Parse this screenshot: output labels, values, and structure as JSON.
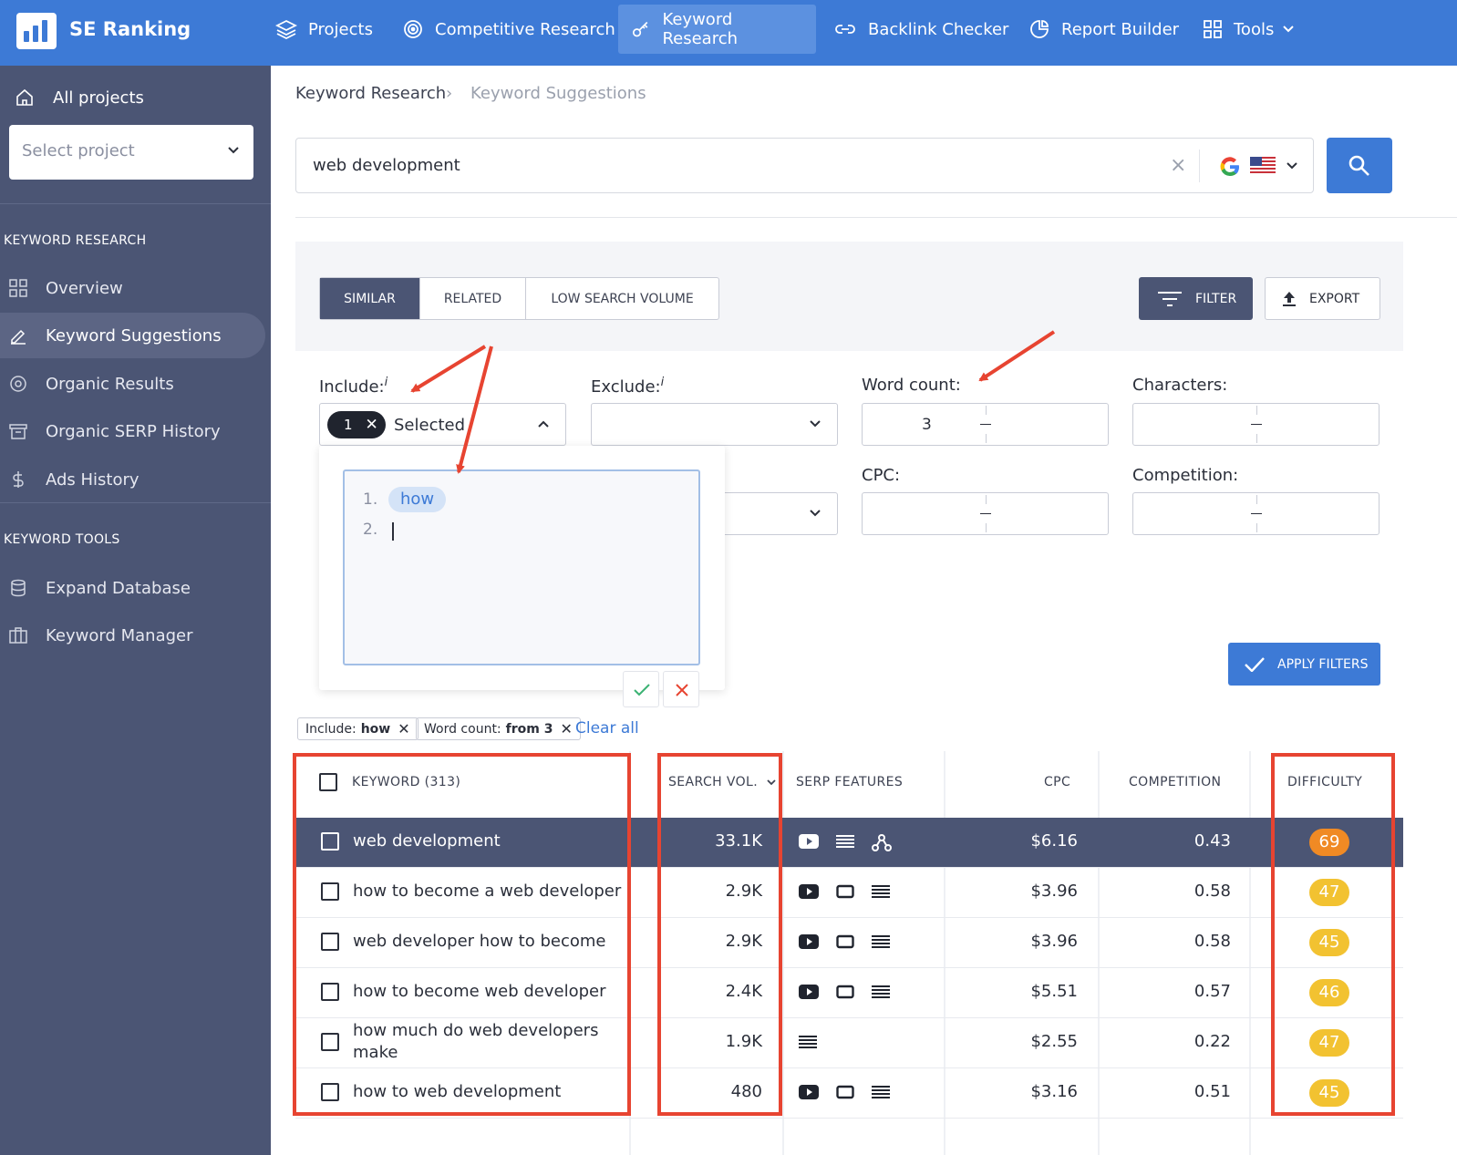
{
  "app": {
    "name": "SE Ranking"
  },
  "nav": {
    "projects": "Projects",
    "competitive": "Competitive Research",
    "keyword": "Keyword Research",
    "backlink": "Backlink Checker",
    "report": "Report Builder",
    "tools": "Tools"
  },
  "sidebar": {
    "all_projects": "All projects",
    "select_project": "Select project",
    "section_research": "KEYWORD RESEARCH",
    "overview": "Overview",
    "suggestions": "Keyword Suggestions",
    "organic": "Organic Results",
    "serp_history": "Organic SERP History",
    "ads_history": "Ads History",
    "section_tools": "KEYWORD TOOLS",
    "expand_db": "Expand Database",
    "manager": "Keyword Manager"
  },
  "breadcrumb": {
    "parent": "Keyword Research",
    "sep": "›",
    "current": "Keyword Suggestions"
  },
  "search": {
    "query": "web development",
    "clear": "×"
  },
  "tabs": {
    "similar": "SIMILAR",
    "related": "RELATED",
    "low": "LOW SEARCH VOLUME"
  },
  "buttons": {
    "filter": "FILTER",
    "export": "EXPORT",
    "apply": "APPLY FILTERS"
  },
  "filters": {
    "include_label": "Include:",
    "exclude_label": "Exclude:",
    "info": "i",
    "word_count_label": "Word count:",
    "characters_label": "Characters:",
    "cpc_label": "CPC:",
    "competition_label": "Competition:",
    "include_count": "1",
    "include_selected": "Selected",
    "word_count_from": "3"
  },
  "include_editor": {
    "line1_num": "1.",
    "line1_tag": "how",
    "line2_num": "2."
  },
  "applied": {
    "include_label": "Include:",
    "include_value": "how",
    "wc_label": "Word count:",
    "wc_value": "from 3",
    "clear_all": "Clear all"
  },
  "table": {
    "headers": {
      "keyword": "KEYWORD",
      "keyword_count": "(313)",
      "search_vol": "SEARCH VOL.",
      "serp": "SERP FEATURES",
      "cpc": "CPC",
      "competition": "COMPETITION",
      "difficulty": "DIFFICULTY"
    },
    "rows": [
      {
        "keyword": "web development",
        "volume": "33.1K",
        "cpc": "$6.16",
        "competition": "0.43",
        "difficulty": "69"
      },
      {
        "keyword": "how to become a web developer",
        "volume": "2.9K",
        "cpc": "$3.96",
        "competition": "0.58",
        "difficulty": "47"
      },
      {
        "keyword": "web developer how to become",
        "volume": "2.9K",
        "cpc": "$3.96",
        "competition": "0.58",
        "difficulty": "45"
      },
      {
        "keyword": "how to become web developer",
        "volume": "2.4K",
        "cpc": "$5.51",
        "competition": "0.57",
        "difficulty": "46"
      },
      {
        "keyword": "how much do web developers make",
        "volume": "1.9K",
        "cpc": "$2.55",
        "competition": "0.22",
        "difficulty": "47"
      },
      {
        "keyword": "how to web development",
        "volume": "480",
        "cpc": "$3.16",
        "competition": "0.51",
        "difficulty": "45"
      }
    ]
  },
  "colors": {
    "brand_blue": "#3d7ad6",
    "sidebar": "#4b5574",
    "annotation_red": "#e74431",
    "difficulty_orange": "#f08a24",
    "difficulty_yellow": "#f2c231"
  }
}
